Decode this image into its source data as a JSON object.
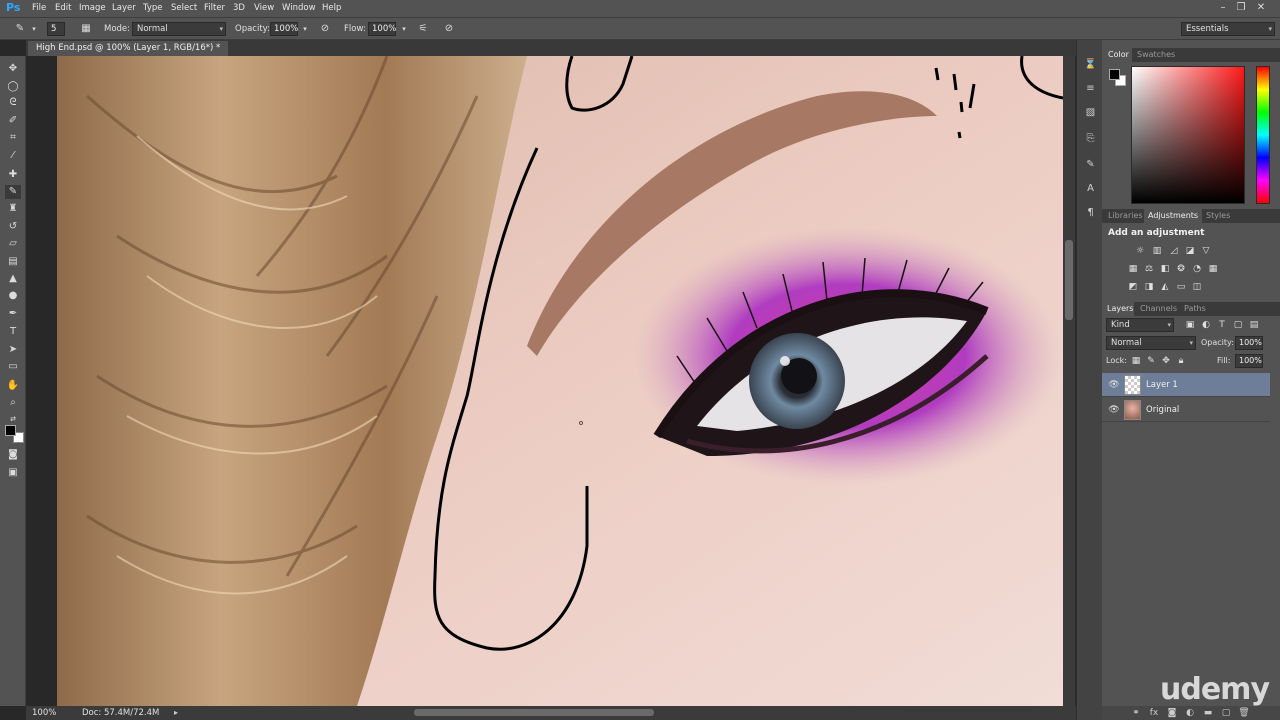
{
  "app": {
    "logo": "Ps"
  },
  "menu": [
    "File",
    "Edit",
    "Image",
    "Layer",
    "Type",
    "Select",
    "Filter",
    "3D",
    "View",
    "Window",
    "Help"
  ],
  "options_bar": {
    "brush_size": "5",
    "mode_label": "Mode:",
    "mode_value": "Normal",
    "opacity_label": "Opacity:",
    "opacity_value": "100%",
    "flow_label": "Flow:",
    "flow_value": "100%",
    "workspace": "Essentials"
  },
  "document": {
    "tab_title": "High End.psd @ 100% (Layer 1, RGB/16*) *",
    "zoom": "100%",
    "doc_size": "Doc: 57.4M/72.4M"
  },
  "color_panel": {
    "tabs": [
      "Color",
      "Swatches"
    ],
    "active_tab": "Color",
    "foreground": "#000000",
    "background": "#ffffff"
  },
  "adjustments_panel": {
    "tabs": [
      "Libraries",
      "Adjustments",
      "Styles"
    ],
    "active_tab": "Adjustments",
    "title": "Add an adjustment"
  },
  "layers_panel": {
    "tabs": [
      "Layers",
      "Channels",
      "Paths"
    ],
    "active_tab": "Layers",
    "filter_kind": "Kind",
    "blend_mode": "Normal",
    "opacity_label": "Opacity:",
    "opacity_value": "100%",
    "lock_label": "Lock:",
    "fill_label": "Fill:",
    "fill_value": "100%",
    "layers": [
      {
        "name": "Layer 1",
        "selected": true
      },
      {
        "name": "Original",
        "selected": false
      }
    ]
  },
  "watermark": "udemy"
}
